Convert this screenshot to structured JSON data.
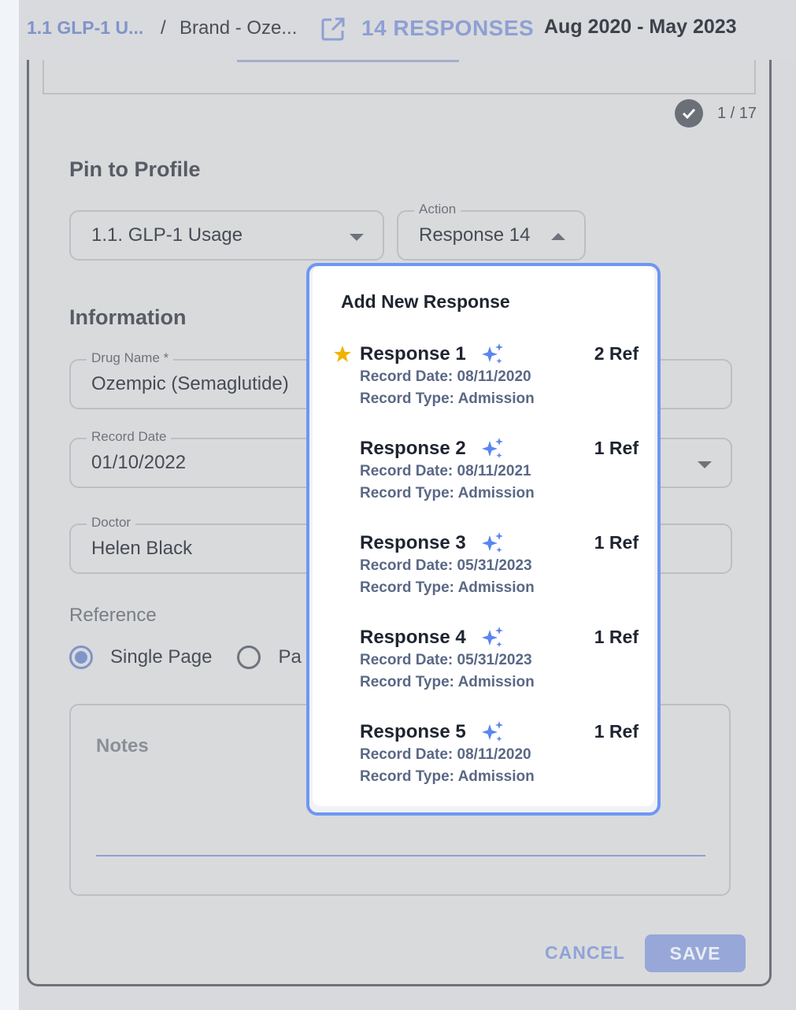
{
  "breadcrumb": {
    "parent": "1.1 GLP-1 U...",
    "separator": "/",
    "current": "Brand - Oze..."
  },
  "header": {
    "responses_count": "14 RESPONSES",
    "date_range": "Aug 2020 - May 2023"
  },
  "progress": {
    "text": "1 / 17"
  },
  "pin_to_profile": {
    "title": "Pin to Profile",
    "profile_select": "1.1. GLP-1 Usage",
    "action_label": "Action",
    "action_value": "Response 14"
  },
  "information": {
    "title": "Information",
    "drug_name_label": "Drug Name *",
    "drug_name_value": "Ozempic (Semaglutide)",
    "record_date_label": "Record Date",
    "record_date_value": "01/10/2022",
    "doctor_label": "Doctor",
    "doctor_value": "Helen Black"
  },
  "reference": {
    "title": "Reference",
    "option_single": "Single Page",
    "option_page_partial": "Pa"
  },
  "notes": {
    "label": "Notes"
  },
  "footer": {
    "cancel": "CANCEL",
    "save": "SAVE"
  },
  "popup": {
    "header": "Add New Response",
    "items": [
      {
        "name": "Response 1",
        "ref": "2 Ref",
        "date": "Record Date: 08/11/2020",
        "type": "Record Type: Admission",
        "starred": true
      },
      {
        "name": "Response 2",
        "ref": "1 Ref",
        "date": "Record Date: 08/11/2021",
        "type": "Record Type: Admission",
        "starred": false
      },
      {
        "name": "Response 3",
        "ref": "1 Ref",
        "date": "Record Date: 05/31/2023",
        "type": "Record Type: Admission",
        "starred": false
      },
      {
        "name": "Response 4",
        "ref": "1 Ref",
        "date": "Record Date: 05/31/2023",
        "type": "Record Type: Admission",
        "starred": false
      },
      {
        "name": "Response 5",
        "ref": "1 Ref",
        "date": "Record Date: 08/11/2020",
        "type": "Record Type: Admission",
        "starred": false
      }
    ]
  },
  "colors": {
    "accent": "#6d97f4",
    "star": "#f0b400",
    "sparkle": "#5b86f0"
  }
}
